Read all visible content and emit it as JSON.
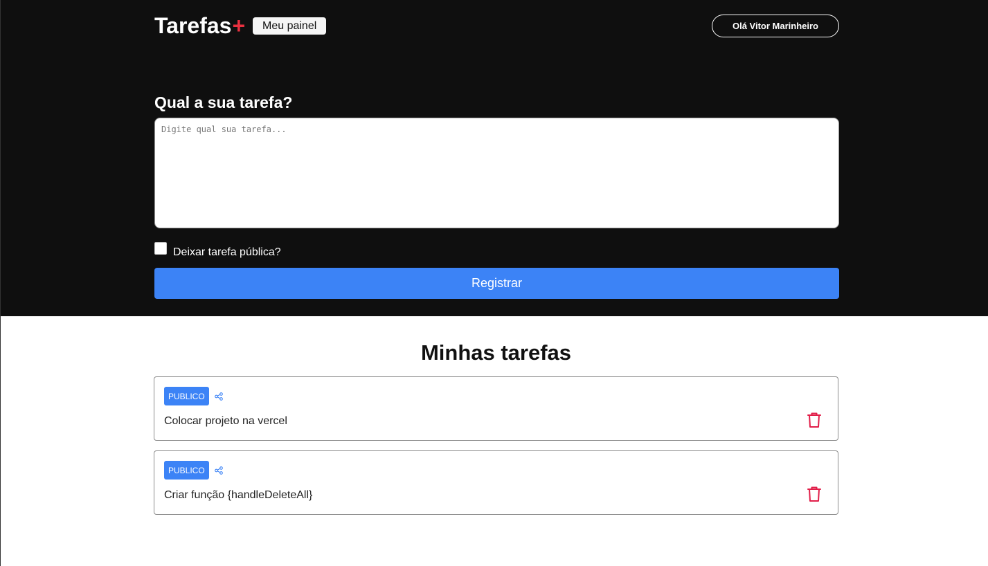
{
  "header": {
    "logo_text": "Tarefas",
    "logo_accent": "+",
    "panel_button": "Meu painel",
    "user_button": "Olá Vitor Marinheiro"
  },
  "form": {
    "title": "Qual a sua tarefa?",
    "textarea_placeholder": "Digite qual sua tarefa...",
    "textarea_value": "",
    "public_label": "Deixar tarefa pública?",
    "public_checked": false,
    "submit_label": "Registrar"
  },
  "tasks_section": {
    "title": "Minhas tarefas",
    "items": [
      {
        "badge": "PUBLICO",
        "text": "Colocar projeto na vercel"
      },
      {
        "badge": "PUBLICO",
        "text": "Criar função {handleDeleteAll}"
      }
    ]
  },
  "colors": {
    "header_bg": "#0f0f0f",
    "accent_red": "#ea3140",
    "primary_blue": "#3c83f6",
    "trash_red": "#e11d48"
  },
  "icons": {
    "share": "share-icon",
    "trash": "trash-icon"
  }
}
